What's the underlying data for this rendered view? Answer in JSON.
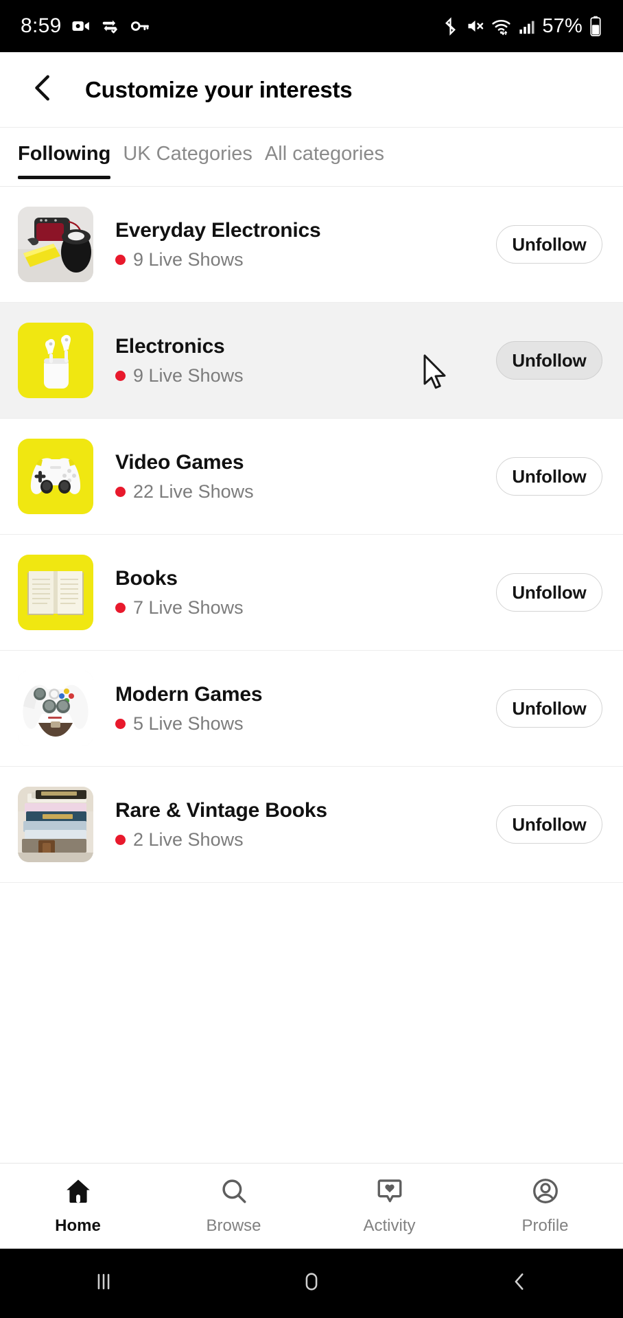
{
  "status_bar": {
    "time": "8:59",
    "battery_percent": "57%",
    "icons": [
      "camcorder-icon",
      "data-sync-icon",
      "key-icon",
      "bluetooth-icon",
      "volume-muted-icon",
      "wifi-icon",
      "cellular-signal-icon",
      "battery-icon"
    ]
  },
  "header": {
    "title": "Customize your interests",
    "back_icon": "chevron-left-icon"
  },
  "tabs": [
    {
      "label": "Following",
      "active": true
    },
    {
      "label": "UK Categories",
      "active": false
    },
    {
      "label": "All categories",
      "active": false
    }
  ],
  "interests": [
    {
      "title": "Everyday Electronics",
      "live_shows": "9 Live Shows",
      "action_label": "Unfollow",
      "thumbnail": "speaker-photo",
      "hovered": false
    },
    {
      "title": "Electronics",
      "live_shows": "9 Live Shows",
      "action_label": "Unfollow",
      "thumbnail": "earbuds-yellow",
      "hovered": true
    },
    {
      "title": "Video Games",
      "live_shows": "22 Live Shows",
      "action_label": "Unfollow",
      "thumbnail": "gamepad-yellow",
      "hovered": false
    },
    {
      "title": "Books",
      "live_shows": "7 Live Shows",
      "action_label": "Unfollow",
      "thumbnail": "open-book-yellow",
      "hovered": false
    },
    {
      "title": "Modern Games",
      "live_shows": "5 Live Shows",
      "action_label": "Unfollow",
      "thumbnail": "xbox-controller-photo",
      "hovered": false
    },
    {
      "title": "Rare & Vintage Books",
      "live_shows": "2 Live Shows",
      "action_label": "Unfollow",
      "thumbnail": "stacked-books-photo",
      "hovered": false
    }
  ],
  "bottom_nav": [
    {
      "label": "Home",
      "icon": "home-icon",
      "active": true
    },
    {
      "label": "Browse",
      "icon": "search-icon",
      "active": false
    },
    {
      "label": "Activity",
      "icon": "chat-heart-icon",
      "active": false
    },
    {
      "label": "Profile",
      "icon": "account-circle-icon",
      "active": false
    }
  ],
  "android_nav": {
    "recents_icon": "recents-icon",
    "home_icon": "home-pill-icon",
    "back_icon": "back-chevron-icon"
  },
  "colors": {
    "accent_yellow": "#F0E711",
    "live_red": "#E8192C",
    "active_text": "#111111",
    "muted_text": "#818181",
    "row_hover": "#F2F2F2"
  }
}
